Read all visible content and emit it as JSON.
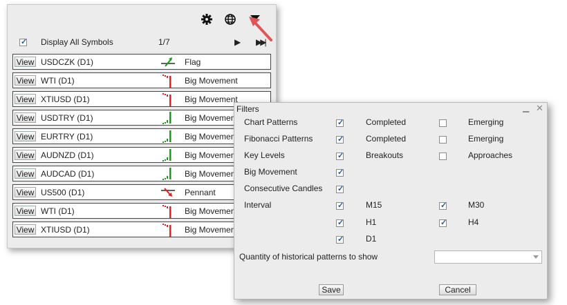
{
  "panel": {
    "display_all_label": "Display All Symbols",
    "page": "1/7",
    "rows": [
      {
        "view": "View",
        "symbol": "USDCZK (D1)",
        "pattern": "Flag",
        "icon": "flag-icon"
      },
      {
        "view": "View",
        "symbol": "WTI (D1)",
        "pattern": "Big Movement",
        "icon": "big-movement-down-icon"
      },
      {
        "view": "View",
        "symbol": "XTIUSD (D1)",
        "pattern": "Big Movement",
        "icon": "big-movement-down-icon"
      },
      {
        "view": "View",
        "symbol": "USDTRY (D1)",
        "pattern": "Big Movement",
        "icon": "big-movement-up-icon"
      },
      {
        "view": "View",
        "symbol": "EURTRY (D1)",
        "pattern": "Big Movement",
        "icon": "big-movement-up-icon"
      },
      {
        "view": "View",
        "symbol": "AUDNZD (D1)",
        "pattern": "Big Movement",
        "icon": "big-movement-up-icon"
      },
      {
        "view": "View",
        "symbol": "AUDCAD (D1)",
        "pattern": "Big Movement",
        "icon": "big-movement-up-icon"
      },
      {
        "view": "View",
        "symbol": "US500 (D1)",
        "pattern": "Pennant",
        "icon": "pennant-icon"
      },
      {
        "view": "View",
        "symbol": "WTI (D1)",
        "pattern": "Big Movement",
        "icon": "big-movement-down-icon"
      },
      {
        "view": "View",
        "symbol": "XTIUSD (D1)",
        "pattern": "Big Movement",
        "icon": "big-movement-down-icon"
      }
    ]
  },
  "filters": {
    "title": "Filters",
    "rows": {
      "chart_patterns": "Chart Patterns",
      "fibonacci_patterns": "Fibonacci Patterns",
      "key_levels": "Key Levels",
      "big_movement": "Big Movement",
      "consecutive_candles": "Consecutive Candles",
      "interval": "Interval"
    },
    "completed": "Completed",
    "emerging": "Emerging",
    "breakouts": "Breakouts",
    "approaches": "Approaches",
    "intervals": {
      "m15": "M15",
      "m30": "M30",
      "h1": "H1",
      "h4": "H4",
      "d1": "D1"
    },
    "quantity_label": "Quantity of historical patterns to show",
    "quantity_value": "",
    "save": "Save",
    "cancel": "Cancel"
  },
  "colors": {
    "accent_green": "#1a9a1a",
    "accent_red": "#e02020",
    "annotation_red": "#e05555"
  }
}
